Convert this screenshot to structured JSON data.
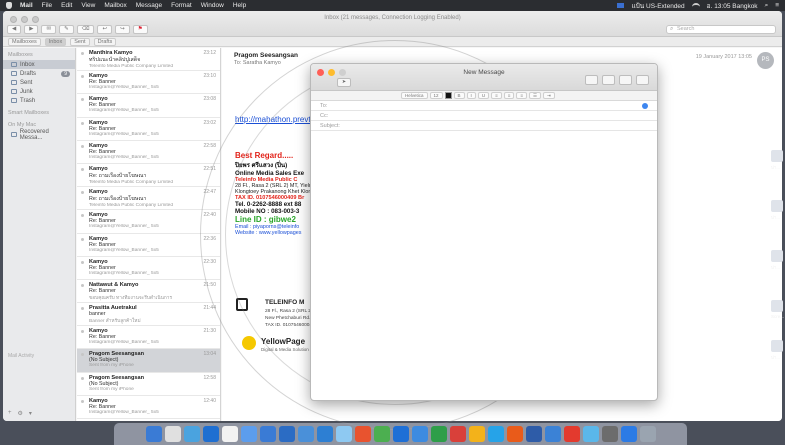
{
  "menubar": {
    "items": [
      "Mail",
      "File",
      "Edit",
      "View",
      "Mailbox",
      "Message",
      "Format",
      "Window",
      "Help"
    ],
    "right_status": "แป้น US-Extended",
    "clock": "อ. 13:05 Bangkok"
  },
  "mail_window": {
    "title": "Inbox (21 messages, Connection Logging Enabled)",
    "toolbar": [
      "◀",
      "▶",
      "✉",
      "✎",
      "⌫",
      "↩",
      "↪",
      "⚑"
    ],
    "search_placeholder": "Search",
    "favorites": [
      "Mailboxes",
      "Inbox",
      "Sent",
      "Drafts"
    ]
  },
  "sidebar": {
    "section1": "Mailboxes",
    "items": [
      {
        "label": "Inbox",
        "badge": ""
      },
      {
        "label": "Drafts",
        "badge": "9"
      },
      {
        "label": "Sent",
        "badge": ""
      },
      {
        "label": "Junk",
        "badge": ""
      },
      {
        "label": "Trash",
        "badge": ""
      }
    ],
    "section2": "Smart Mailboxes",
    "section3": "On My Mac",
    "items2": [
      {
        "label": "Recovered Messa..."
      }
    ],
    "bottom_label": "Mail Activity",
    "bottom_icons": [
      "+",
      "⚙",
      "▾"
    ]
  },
  "messages": [
    {
      "from": "Manthira Kamyo",
      "date": "23:12",
      "subj": "ทริปแนะนำคลิปปูเสด็จ",
      "prev": "Teleinfo Media Public Company Limited"
    },
    {
      "from": "Kamyo",
      "date": "23:10",
      "subj": "Re: Banner",
      "prev": "Instagram@Yellow_Banner_ 5x5"
    },
    {
      "from": "Kamyo",
      "date": "23:08",
      "subj": "Re: Banner",
      "prev": "Instagram@Yellow_Banner_ 5x5"
    },
    {
      "from": "Kamyo",
      "date": "23:02",
      "subj": "Re: Banner",
      "prev": "Instagram@Yellow_Banner_ 5x5"
    },
    {
      "from": "Kamyo",
      "date": "22:58",
      "subj": "Re: Banner",
      "prev": "Instagram@Yellow_Banner_ 5x5"
    },
    {
      "from": "Kamyo",
      "date": "22:51",
      "subj": "Re: ถามเรื่องป้ายโฆษณา",
      "prev": "Teleinfo Media Public Company Limited"
    },
    {
      "from": "Kamyo",
      "date": "22:47",
      "subj": "Re: ถามเรื่องป้ายโฆษณา",
      "prev": "Teleinfo Media Public Company Limited"
    },
    {
      "from": "Kamyo",
      "date": "22:40",
      "subj": "Re: Banner",
      "prev": "Instagram@Yellow_Banner_ 5x5"
    },
    {
      "from": "Kamyo",
      "date": "22:36",
      "subj": "Re: Banner",
      "prev": "Instagram@Yellow_Banner_ 5x5"
    },
    {
      "from": "Kamyo",
      "date": "22:30",
      "subj": "Re: Banner",
      "prev": "Instagram@Yellow_Banner_ 5x5"
    },
    {
      "from": "Nattawut & Kamyo",
      "date": "21:50",
      "subj": "Re: Banner",
      "prev": "ขอบคุณครับ ทางทีมงานจะรีบดำเนินการ"
    },
    {
      "from": "Prasitta Auetrakul",
      "date": "21:44",
      "subj": "banner",
      "prev": "Banner สำหรับลูกค้าใหม่"
    },
    {
      "from": "Kamyo",
      "date": "21:30",
      "subj": "Re: Banner",
      "prev": "Instagram@Yellow_Banner_ 5x5"
    },
    {
      "from": "Pragom Seesangsan",
      "date": "13:04",
      "subj": "(No Subject)",
      "prev": "Sent from my iPhone"
    },
    {
      "from": "Pragom Seesangsan",
      "date": "12:58",
      "subj": "(No Subject)",
      "prev": "Sent from my iPhone"
    },
    {
      "from": "Kamyo",
      "date": "12:40",
      "subj": "Re: Banner",
      "prev": "Instagram@Yellow_Banner_ 5x5"
    }
  ],
  "reading": {
    "from": "Pragom Seesangsan",
    "to": "To: Saratha Kamyo",
    "date": "19 January 2017 13:05",
    "avatar": "PS",
    "link": "http://mahathon.prevt",
    "signature": {
      "best": "Best Regard.....",
      "name": "ปิยพร ศรีแสวง (ปิ่น)",
      "line1": "Online Media Sales Exe",
      "line2": "Teleinfo Media Public C",
      "line3": "28 Fl., Rasa 2 (SRL 2) MT, Yield B",
      "line4": "Klongtoey Prakanong Khet Klongto",
      "line5": "TAX ID. 0107546000409 Br",
      "tel": "Tel. 0-2262-8888 ext 88",
      "mobile": "Mobile NO : 083-003-3",
      "lineid": "Line ID  : gibwe2",
      "email": "Email : piyaporns@teleinfo",
      "website": "Website : www.yellowpages"
    },
    "teleinfo_title": "TELEINFO M",
    "teleinfo_addr": "28 Fl., Rasa 2 (SRL 2) MT\nNew Phetchaburi Rd.\nTAX ID. 0107546000409",
    "yp_name": "YellowPage",
    "yp_sub": "Digital & Media Solution"
  },
  "compose": {
    "title": "New Message",
    "send": "➤",
    "format": {
      "font": "Helvetica",
      "size": "12"
    },
    "to_label": "To:",
    "cc_label": "Cc:",
    "subject_label": "Subject:"
  },
  "desktop": {
    "labels": [
      "ปา...",
      "ปา...",
      "ปา...",
      "Scre...",
      "ปา..."
    ]
  }
}
